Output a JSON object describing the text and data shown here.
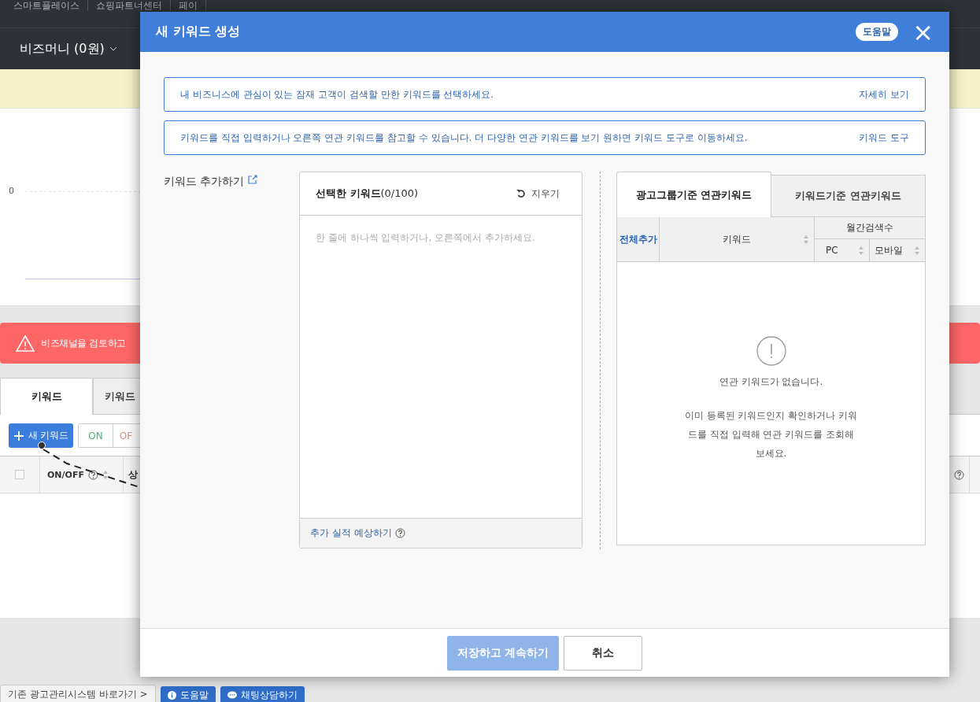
{
  "background": {
    "top_menu": [
      "스마트플레이스",
      "쇼핑파트너센터",
      "페이"
    ],
    "bizmoney": "비즈머니 (0원)",
    "chart_axis_label": "0",
    "alert": "비즈채널을 검토하고",
    "tabs": [
      {
        "label": "키워드",
        "selected": true
      },
      {
        "label": "키워드",
        "selected": false
      }
    ],
    "new_keyword_button": "새 키워드",
    "toggle_buttons": [
      {
        "label": "ON",
        "color": "#4caf7d"
      },
      {
        "label": "OF",
        "color": "#d98b8b"
      }
    ],
    "table_header": {
      "select_all_checked": false,
      "column_1": "ON/OFF",
      "column_2": "상"
    },
    "footer": {
      "legacy_link": "기존 광고관리시스템 바로가기 >",
      "help_button": "도움말",
      "chat_button": "채팅상담하기"
    }
  },
  "modal": {
    "title": "새 키워드 생성",
    "help_button": "도움말",
    "close": "×",
    "info_boxes": [
      {
        "text": "내 비즈니스에 관심이 있는 잠재 고객이 검색할 만한 키워드를 선택하세요.",
        "link": "자세히 보기"
      },
      {
        "text": "키워드를 직접 입력하거나 오른쪽 연관 키워드를 참고할 수 있습니다. 더 다양한 연관 키워드를 보기 원하면 키워드 도구로 이동하세요.",
        "link": "키워드 도구"
      }
    ],
    "add_label": "키워드 추가하기",
    "selected_panel": {
      "title": "선택한 키워드",
      "count": "(0/100)",
      "clear": "지우기",
      "placeholder": "한 줄에 하나씩 입력하거나, 오른쪽에서 추가하세요.",
      "estimate_link": "추가 실적 예상하기"
    },
    "related": {
      "tabs": [
        {
          "label": "광고그룹기준 연관키워드",
          "selected": true
        },
        {
          "label": "키워드기준 연관키워드",
          "selected": false
        }
      ],
      "columns": {
        "add_all": "전체추가",
        "keyword": "키워드",
        "monthly": "월간검색수",
        "pc": "PC",
        "mobile": "모바일"
      },
      "empty_title": "연관 키워드가 없습니다.",
      "empty_detail": "이미 등록된 키워드인지 확인하거나 키워드를 직접 입력해 연관 키워드를 조회해 보세요."
    },
    "buttons": [
      {
        "label": "저장하고 계속하기",
        "kind": "primary",
        "disabled": true
      },
      {
        "label": "취소",
        "kind": "secondary",
        "disabled": false
      }
    ]
  }
}
